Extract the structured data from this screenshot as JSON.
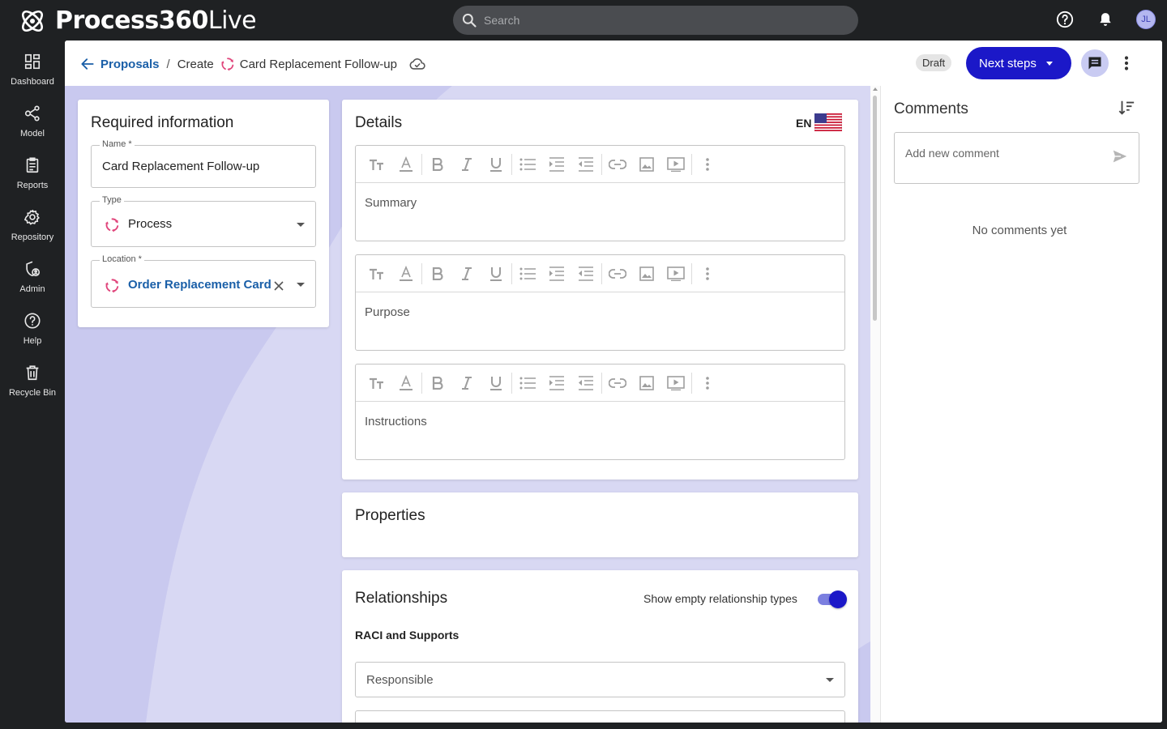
{
  "app": {
    "name_bold": "Process360",
    "name_light": "Live",
    "user_initials": "JL"
  },
  "search": {
    "placeholder": "Search"
  },
  "sidebar": {
    "items": [
      {
        "label": "Dashboard",
        "icon": "dashboard-icon"
      },
      {
        "label": "Model",
        "icon": "model-icon"
      },
      {
        "label": "Reports",
        "icon": "reports-icon"
      },
      {
        "label": "Repository",
        "icon": "repository-icon"
      },
      {
        "label": "Admin",
        "icon": "admin-icon"
      },
      {
        "label": "Help",
        "icon": "help-icon"
      },
      {
        "label": "Recycle Bin",
        "icon": "trash-icon"
      }
    ]
  },
  "header": {
    "breadcrumb_link": "Proposals",
    "breadcrumb_sep": "/",
    "breadcrumb_create": "Create",
    "breadcrumb_item": "Card Replacement Follow-up",
    "status": "Draft",
    "next_steps": "Next steps"
  },
  "required": {
    "title": "Required information",
    "name_label": "Name *",
    "name_value": "Card Replacement Follow-up",
    "type_label": "Type",
    "type_value": "Process",
    "location_label": "Location *",
    "location_value": "Order Replacement Card"
  },
  "details": {
    "title": "Details",
    "language": "EN",
    "editors": [
      {
        "placeholder": "Summary"
      },
      {
        "placeholder": "Purpose"
      },
      {
        "placeholder": "Instructions"
      }
    ]
  },
  "properties": {
    "title": "Properties"
  },
  "relationships": {
    "title": "Relationships",
    "toggle_label": "Show empty relationship types",
    "toggle_on": true,
    "section": "RACI and Supports",
    "responsible": "Responsible"
  },
  "comments": {
    "title": "Comments",
    "placeholder": "Add new comment",
    "empty": "No comments yet"
  },
  "colors": {
    "accent": "#1b18c8",
    "link": "#1a5fa8",
    "process_icon": "#e0457b",
    "content_bg": "#d8d8f3"
  }
}
